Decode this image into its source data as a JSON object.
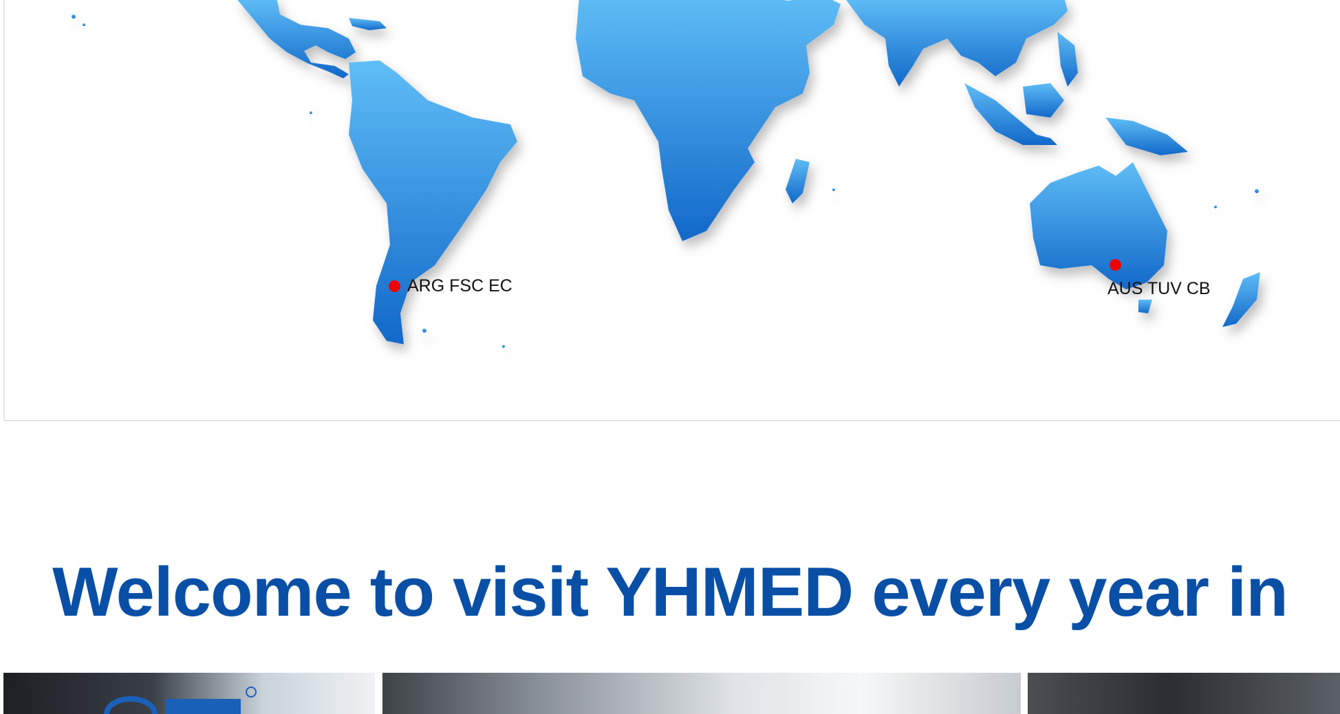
{
  "map": {
    "markers": [
      {
        "label": "ARG FSC EC"
      },
      {
        "label": "AUS TUV CB"
      }
    ]
  },
  "welcome": {
    "title": "Welcome to visit YHMED every year in"
  },
  "photos": [
    {
      "name": "exhibition-booth-photo"
    },
    {
      "name": "exhibition-hall-photo"
    },
    {
      "name": "exhibition-ceiling-photo"
    }
  ],
  "colors": {
    "land_top": "#5fbdf6",
    "land_bottom": "#1268c9",
    "marker": "#f20000",
    "headline": "#0a4fa6"
  }
}
